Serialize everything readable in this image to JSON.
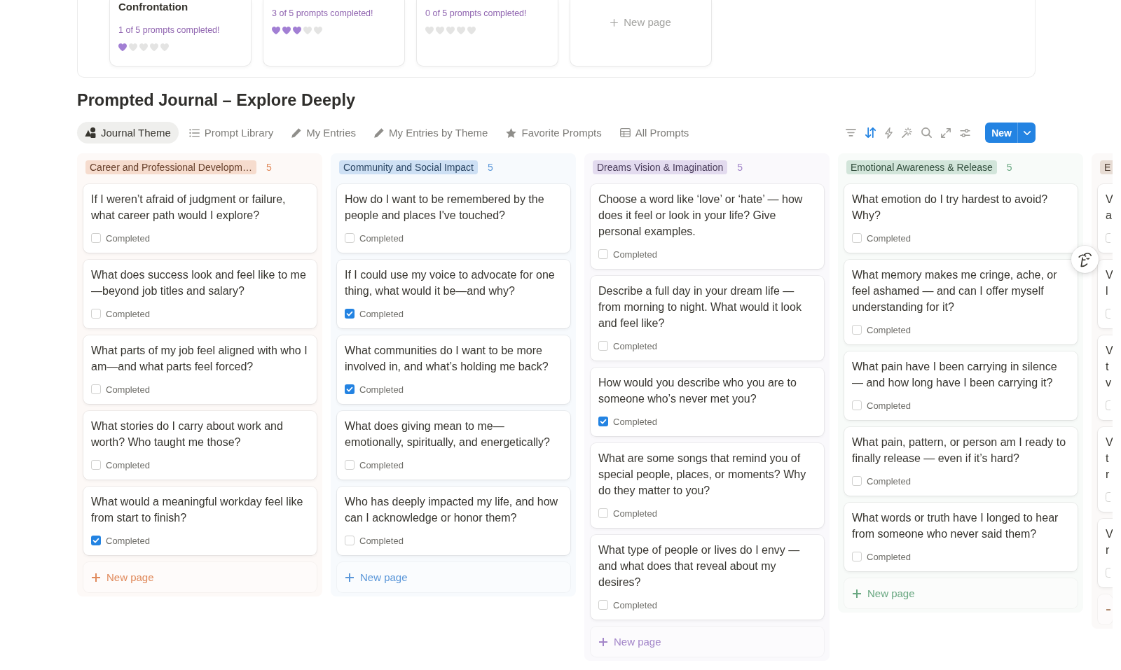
{
  "gallery": {
    "cards": [
      {
        "title": "Confrontation",
        "progress": "1 of 5 prompts completed!",
        "stars": 1
      },
      {
        "progress": "3 of 5 prompts completed!",
        "stars": 3
      },
      {
        "progress": "0 of 5 prompts completed!",
        "stars": 0
      }
    ],
    "new_page": "New page"
  },
  "title": "Prompted Journal – Explore Deeply",
  "tabs": [
    {
      "label": "Journal Theme",
      "selected": true
    },
    {
      "label": "Prompt Library",
      "selected": false
    },
    {
      "label": "My Entries",
      "selected": false
    },
    {
      "label": "My Entries by Theme",
      "selected": false
    },
    {
      "label": "Favorite Prompts",
      "selected": false
    },
    {
      "label": "All Prompts",
      "selected": false
    }
  ],
  "toolbar": {
    "sorted": true,
    "new_button": "New"
  },
  "board": {
    "columns": [
      {
        "kind": "full",
        "title": "Career and Professional Developm…",
        "count": "5",
        "color": "#e08a5c",
        "cards": [
          {
            "text": "If I weren’t afraid of judgment or failure, what career path would I explore?",
            "label": "Completed",
            "completed": false
          },
          {
            "text": "What does success look and feel like to me—beyond job titles and salary?",
            "label": "Completed",
            "completed": false
          },
          {
            "text": "What parts of my job feel aligned with who I am—and what parts feel forced?",
            "label": "Completed",
            "completed": false
          },
          {
            "text": "What stories do I carry about work and worth? Who taught me those?",
            "label": "Completed",
            "completed": false
          },
          {
            "text": "What would a meaningful workday feel like from start to finish?",
            "label": "Completed",
            "completed": true
          }
        ],
        "new_page": "New page"
      },
      {
        "kind": "full",
        "title": "Community and Social Impact",
        "count": "5",
        "color": "#5b97d9",
        "cards": [
          {
            "text": "How do I want to be remembered by the people and places I've touched?",
            "label": "Completed",
            "completed": false
          },
          {
            "text": "If I could use my voice to advocate for one thing, what would it be—and why?",
            "label": "Completed",
            "completed": true
          },
          {
            "text": "What communities do I want to be more involved in, and what’s holding me back?",
            "label": "Completed",
            "completed": true
          },
          {
            "text": "What does giving mean to me—emotionally, spiritually, and energetically?",
            "label": "Completed",
            "completed": false
          },
          {
            "text": "Who has deeply impacted my life, and how can I acknowledge or honor them?",
            "label": "Completed",
            "completed": false
          }
        ],
        "new_page": "New page"
      },
      {
        "kind": "full",
        "title": "Dreams Vision & Imagination",
        "count": "5",
        "color": "#a386c9",
        "cards": [
          {
            "text": "Choose a word like ‘love’ or ‘hate’ — how does it feel or look in your life? Give personal examples.",
            "label": "Completed",
            "completed": false
          },
          {
            "text": "Describe a full day in your dream life — from morning to night. What would it look and feel like?",
            "label": "Completed",
            "completed": false
          },
          {
            "text": "How would you describe who you are to someone who’s never met you?",
            "label": "Completed",
            "completed": true
          },
          {
            "text": "What are some songs that remind you of special people, places, or moments? Why do they matter to you?",
            "label": "Completed",
            "completed": false
          },
          {
            "text": "What type of people or lives do I envy — and what does that reveal about my desires?",
            "label": "Completed",
            "completed": false
          }
        ],
        "new_page": "New page"
      },
      {
        "kind": "full",
        "title": "Emotional Awareness & Release",
        "count": "5",
        "color": "#6aa882",
        "cards": [
          {
            "text": "What emotion do I try hardest to avoid? Why?",
            "label": "Completed",
            "completed": false
          },
          {
            "text": "What memory makes me cringe, ache, or feel ashamed — and can I offer myself understanding for it?",
            "label": "Completed",
            "completed": false
          },
          {
            "text": "What pain have I been carrying in silence — and how long have I been carrying it?",
            "label": "Completed",
            "completed": false
          },
          {
            "text": "What pain, pattern, or person am I ready to finally release — even if it’s hard?",
            "label": "Completed",
            "completed": false
          },
          {
            "text": "What words or truth have I longed to hear from someone who never said them?",
            "label": "Completed",
            "completed": false
          }
        ],
        "new_page": "New page"
      },
      {
        "kind": "edge",
        "title": "E",
        "color": "#b08a6e",
        "cards": [
          {
            "text": "V a",
            "completed": false
          },
          {
            "text": "V l",
            "completed": false
          },
          {
            "text": "V t v",
            "completed": false
          },
          {
            "text": "V t r",
            "completed": false
          },
          {
            "text": "V r",
            "completed": false
          }
        ]
      }
    ]
  }
}
